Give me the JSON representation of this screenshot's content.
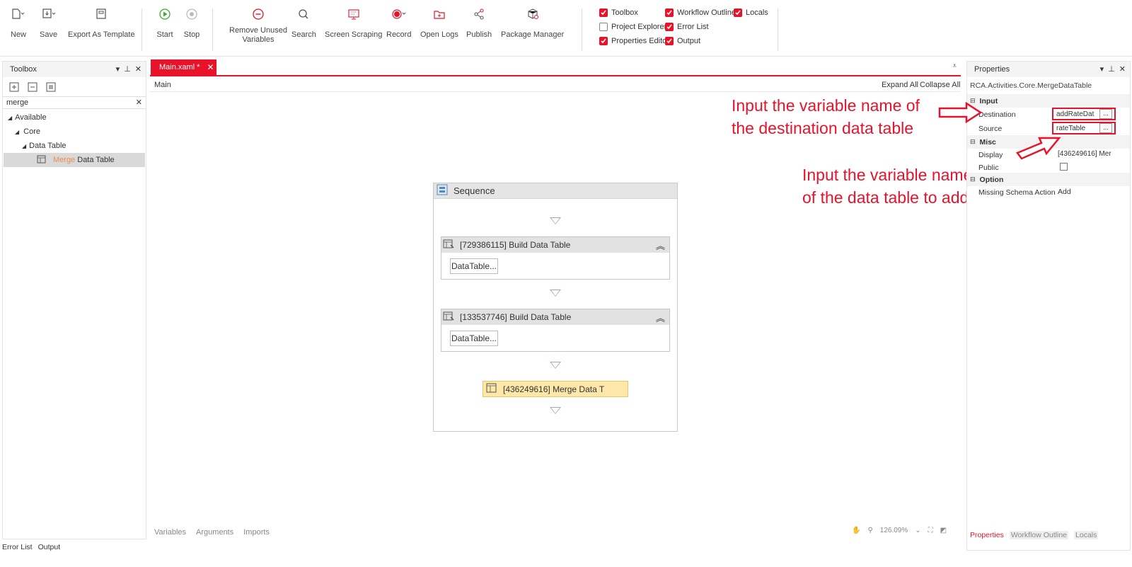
{
  "ribbon": {
    "new": "New",
    "save": "Save",
    "export_template": "Export As Template",
    "start": "Start",
    "stop": "Stop",
    "remove_unused_1": "Remove Unused",
    "remove_unused_2": "Variables",
    "search": "Search",
    "screen_scraping": "Screen Scraping",
    "record": "Record",
    "open_logs": "Open Logs",
    "publish": "Publish",
    "package_manager": "Package Manager",
    "checks": {
      "toolbox": "Toolbox",
      "workflow_outline": "Workflow Outline",
      "locals": "Locals",
      "project_explorer": "Project Explorer",
      "error_list": "Error List",
      "properties_editor": "Properties Editor",
      "output": "Output"
    }
  },
  "toolbox": {
    "title": "Toolbox",
    "search_value": "merge",
    "tree": {
      "available": "Available",
      "core": "Core",
      "data_table": "Data Table",
      "item_highlight": "Merge",
      "item_rest": " Data Table"
    }
  },
  "designer": {
    "tab": "Main.xaml *",
    "breadcrumb": "Main",
    "expand_all": "Expand All",
    "collapse_all": "Collapse All",
    "sequence_title": "Sequence",
    "activity1": "[729386115] Build Data Table",
    "activity2": "[133537746] Build Data Table",
    "datatable_btn": "DataTable...",
    "merge_activity": "[436249616] Merge Data T",
    "bottom_tabs": [
      "Variables",
      "Arguments",
      "Imports"
    ],
    "zoom": "126.09%"
  },
  "properties": {
    "title": "Properties",
    "type": "RCA.Activities.Core.MergeDataTable",
    "sections": {
      "input": "Input",
      "misc": "Misc",
      "option": "Option"
    },
    "destination_label": "Destination",
    "destination_value": "addRateDat",
    "source_label": "Source",
    "source_value": "rateTable",
    "display_label": "Display",
    "display_value": "[436249616] Mer",
    "public_label": "Public",
    "missing_schema_label": "Missing Schema Action",
    "missing_schema_value": "Add",
    "ellipsis": "...",
    "bottom_tabs": [
      "Properties",
      "Workflow Outline",
      "Locals"
    ]
  },
  "annotations": {
    "a1_line1": "Input the variable name of",
    "a1_line2": "the destination data table",
    "a2_line1": "Input the variable name",
    "a2_line2": "of the data table to add"
  },
  "bottom_bar": [
    "Error List",
    "Output"
  ],
  "colors": {
    "accent": "#e8132b",
    "merge_fill": "#fde7a9",
    "green": "#3aaa35"
  }
}
